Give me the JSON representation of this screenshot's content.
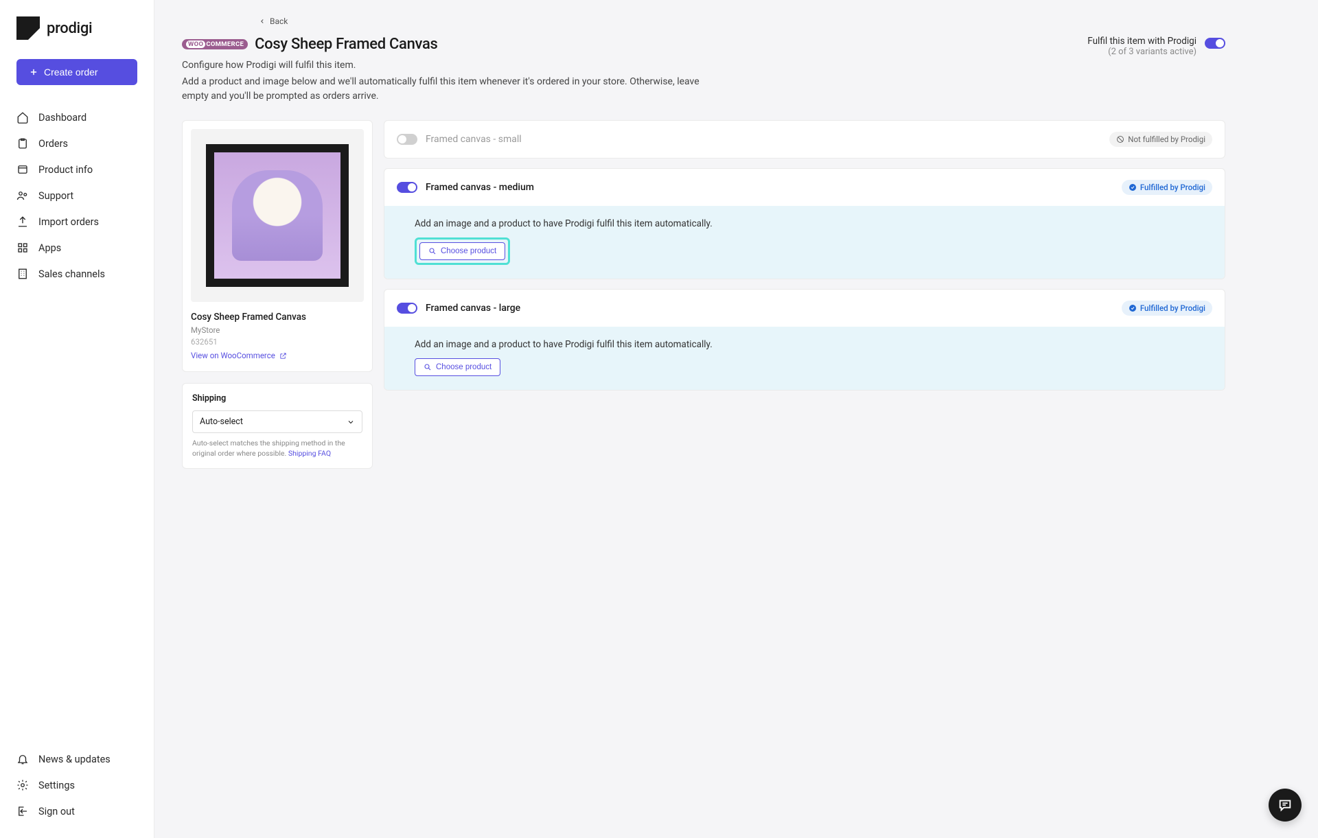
{
  "brand": "prodigi",
  "create_order_label": "Create order",
  "nav": {
    "dashboard": "Dashboard",
    "orders": "Orders",
    "product_info": "Product info",
    "support": "Support",
    "import_orders": "Import orders",
    "apps": "Apps",
    "sales_channels": "Sales channels"
  },
  "nav_foot": {
    "news": "News & updates",
    "settings": "Settings",
    "signout": "Sign out"
  },
  "back_label": "Back",
  "woo_badge": {
    "pre": "WOO",
    "post": "COMMERCE"
  },
  "page_title": "Cosy Sheep Framed Canvas",
  "subtitle": "Configure how Prodigi will fulfil this item.",
  "subdesc": "Add a product and image below and we'll automatically fulfil this item whenever it's ordered in your store. Otherwise, leave empty and you'll be prompted as orders arrive.",
  "header_right": {
    "fulfil": "Fulfil this item with Prodigi",
    "variants": "(2 of 3 variants active)"
  },
  "product": {
    "name": "Cosy Sheep Framed Canvas",
    "store": "MyStore",
    "id": "632651",
    "view_link": "View on WooCommerce"
  },
  "shipping": {
    "title": "Shipping",
    "selected": "Auto-select",
    "help": "Auto-select matches the shipping method in the original order where possible.",
    "faq_label": "Shipping FAQ"
  },
  "badges": {
    "not": "Not fulfilled by Prodigi",
    "yes": "Fulfilled by Prodigi"
  },
  "variant_body_text": "Add an image and a product to have Prodigi fulfil this item automatically.",
  "choose_product_label": "Choose product",
  "variants": [
    {
      "name": "Framed canvas - small",
      "enabled": false,
      "fulfilled": false
    },
    {
      "name": "Framed canvas - medium",
      "enabled": true,
      "fulfilled": true,
      "highlighted": true
    },
    {
      "name": "Framed canvas - large",
      "enabled": true,
      "fulfilled": true,
      "highlighted": false
    }
  ]
}
